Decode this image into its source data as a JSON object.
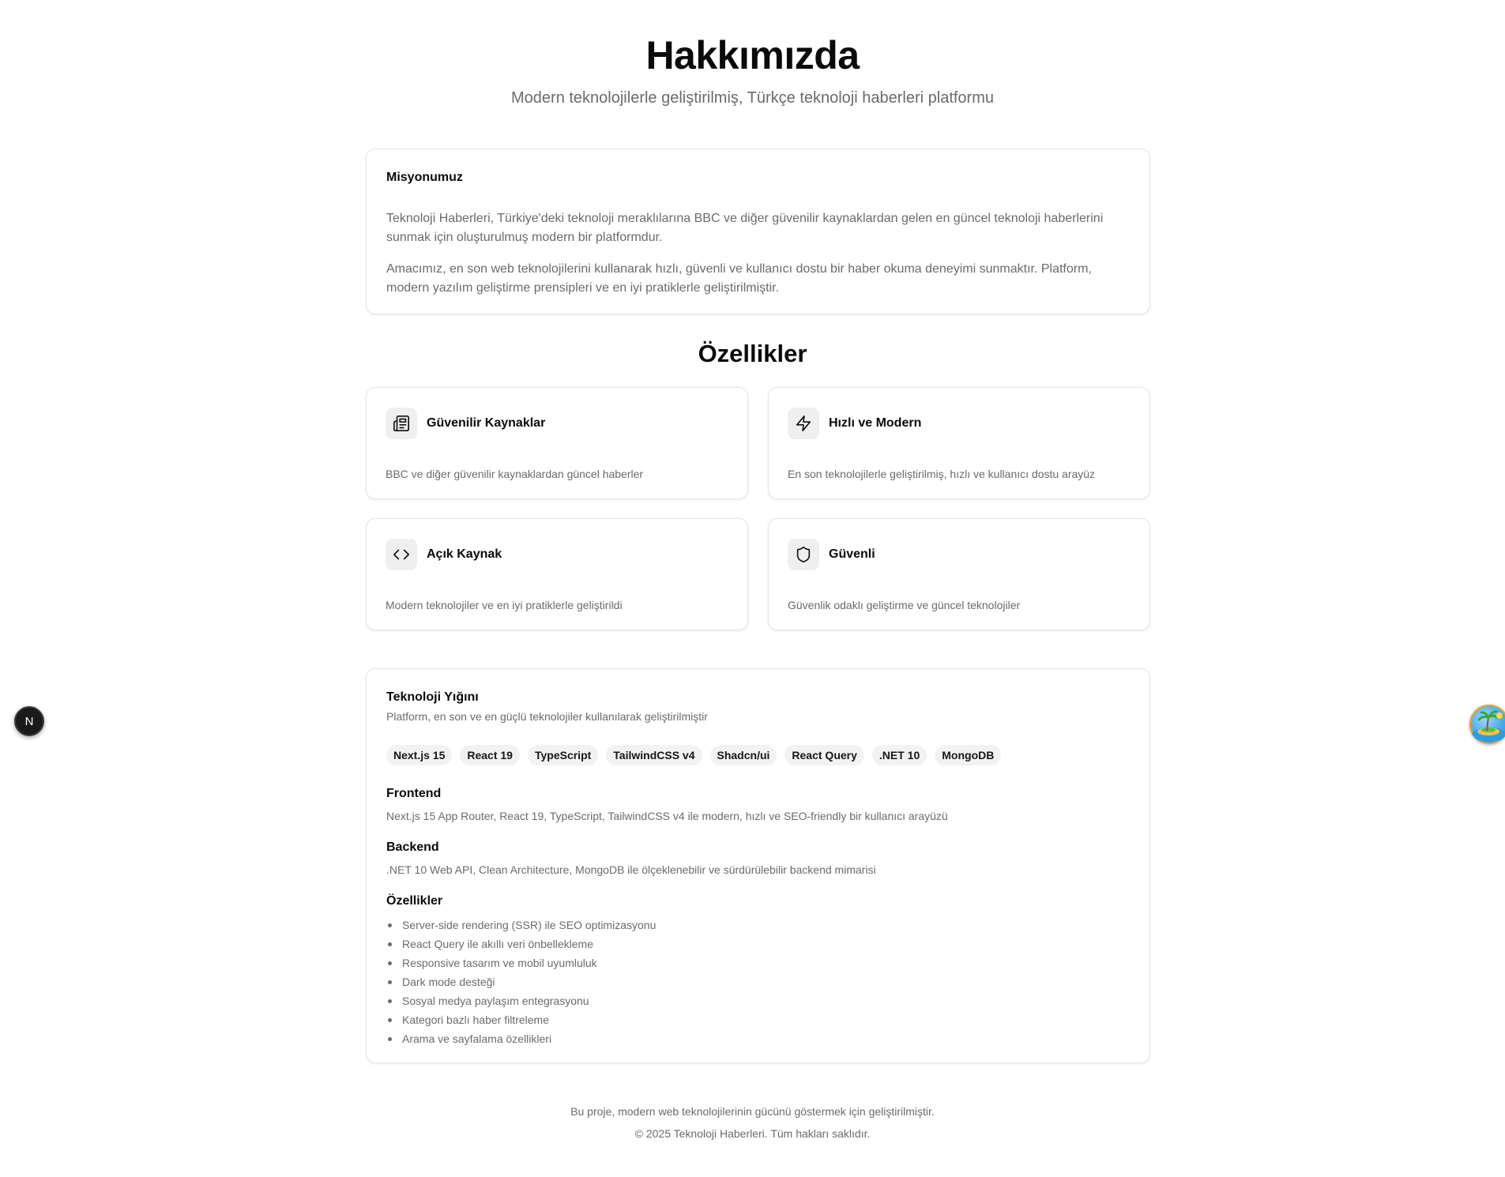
{
  "header": {
    "title": "Hakkımızda",
    "subtitle": "Modern teknolojilerle geliştirilmiş, Türkçe teknoloji haberleri platformu"
  },
  "mission": {
    "title": "Misyonumuz",
    "paragraph1": "Teknoloji Haberleri, Türkiye'deki teknoloji meraklılarına BBC ve diğer güvenilir kaynaklardan gelen en güncel teknoloji haberlerini sunmak için oluşturulmuş modern bir platformdur.",
    "paragraph2": "Amacımız, en son web teknolojilerini kullanarak hızlı, güvenli ve kullanıcı dostu bir haber okuma deneyimi sunmaktır. Platform, modern yazılım geliştirme prensipleri ve en iyi pratiklerle geliştirilmiştir."
  },
  "features": {
    "title": "Özellikler",
    "items": [
      {
        "icon": "newspaper-icon",
        "title": "Güvenilir Kaynaklar",
        "description": "BBC ve diğer güvenilir kaynaklardan güncel haberler"
      },
      {
        "icon": "lightning-icon",
        "title": "Hızlı ve Modern",
        "description": "En son teknolojilerle geliştirilmiş, hızlı ve kullanıcı dostu arayüz"
      },
      {
        "icon": "code-icon",
        "title": "Açık Kaynak",
        "description": "Modern teknolojiler ve en iyi pratiklerle geliştirildi"
      },
      {
        "icon": "shield-icon",
        "title": "Güvenli",
        "description": "Güvenlik odaklı geliştirme ve güncel teknolojiler"
      }
    ]
  },
  "tech_stack": {
    "title": "Teknoloji Yığını",
    "subtitle": "Platform, en son ve en güçlü teknolojiler kullanılarak geliştirilmiştir",
    "badges": [
      "Next.js 15",
      "React 19",
      "TypeScript",
      "TailwindCSS v4",
      "Shadcn/ui",
      "React Query",
      ".NET 10",
      "MongoDB"
    ],
    "frontend": {
      "title": "Frontend",
      "text": "Next.js 15 App Router, React 19, TypeScript, TailwindCSS v4 ile modern, hızlı ve SEO-friendly bir kullanıcı arayüzü"
    },
    "backend": {
      "title": "Backend",
      "text": ".NET 10 Web API, Clean Architecture, MongoDB ile ölçeklenebilir ve sürdürülebilir backend mimarisi"
    },
    "features": {
      "title": "Özellikler",
      "items": [
        "Server-side rendering (SSR) ile SEO optimizasyonu",
        "React Query ile akıllı veri önbellekleme",
        "Responsive tasarım ve mobil uyumluluk",
        "Dark mode desteği",
        "Sosyal medya paylaşım entegrasyonu",
        "Kategori bazlı haber filtreleme",
        "Arama ve sayfalama özellikleri"
      ]
    }
  },
  "footer": {
    "line1": "Bu proje, modern web teknolojilerinin gücünü göstermek için geliştirilmiştir.",
    "line2": "© 2025 Teknoloji Haberleri. Tüm hakları saklıdır."
  },
  "widgets": {
    "next_badge_letter": "N"
  }
}
